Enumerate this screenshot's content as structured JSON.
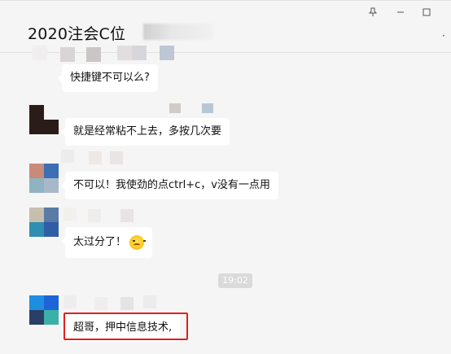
{
  "window": {
    "title": "2020注会C位",
    "pin_icon": "pin-icon",
    "minimize_icon": "minimize-icon",
    "maximize_icon": "maximize-icon",
    "more_icon": "more-icon"
  },
  "messages": [
    {
      "text": "快捷键不可以么?"
    },
    {
      "text": "就是经常粘不上去，多按几次要"
    },
    {
      "text": "不可以！我使劲的点ctrl+c，v没有一点用"
    },
    {
      "text": "太过分了！",
      "emoji": "angry-face-emoji"
    },
    {
      "text": "超哥，押中信息技术,"
    }
  ],
  "timestamp": "19:02",
  "colors": {
    "background": "#f5f5f5",
    "bubble": "#ffffff",
    "highlight": "#e02020",
    "timestamp_bg": "#dadada"
  }
}
